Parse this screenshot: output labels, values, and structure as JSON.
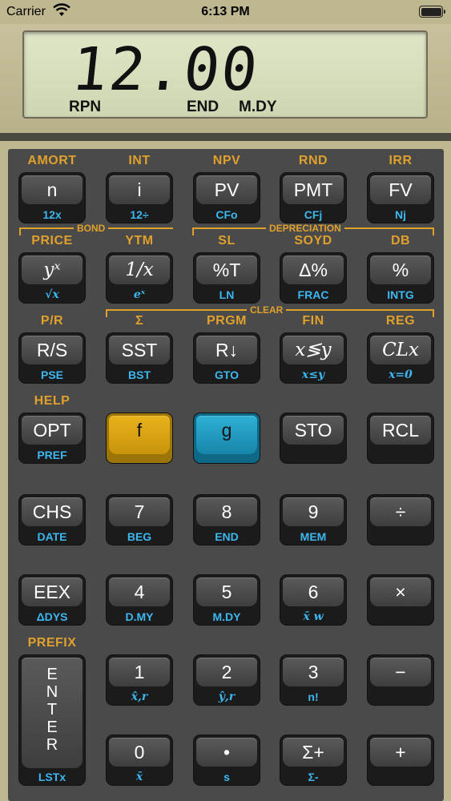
{
  "status_bar": {
    "carrier": "Carrier",
    "time": "6:13 PM"
  },
  "display": {
    "value": "12.00",
    "annunciators": [
      "RPN",
      "END",
      "M.DY"
    ]
  },
  "group_labels": {
    "bond": "BOND",
    "depreciation": "DEPRECIATION",
    "clear": "CLEAR"
  },
  "rows": [
    {
      "f_labels": [
        "AMORT",
        "INT",
        "NPV",
        "RND",
        "IRR"
      ],
      "keys": [
        {
          "main": "n",
          "g": "12x"
        },
        {
          "main": "i",
          "g": "12÷"
        },
        {
          "main": "PV",
          "g": "CFo"
        },
        {
          "main": "PMT",
          "g": "CFj"
        },
        {
          "main": "FV",
          "g": "Nj"
        }
      ]
    },
    {
      "f_labels": [
        "PRICE",
        "YTM",
        "SL",
        "SOYD",
        "DB"
      ],
      "keys": [
        {
          "main": "yˣ",
          "g": "√x"
        },
        {
          "main": "1/x",
          "g": "eˣ"
        },
        {
          "main": "%T",
          "g": "LN"
        },
        {
          "main": "Δ%",
          "g": "FRAC"
        },
        {
          "main": "%",
          "g": "INTG"
        }
      ]
    },
    {
      "f_labels": [
        "P/R",
        "Σ",
        "PRGM",
        "FIN",
        "REG"
      ],
      "keys": [
        {
          "main": "R/S",
          "g": "PSE"
        },
        {
          "main": "SST",
          "g": "BST"
        },
        {
          "main": "R↓",
          "g": "GTO"
        },
        {
          "main": "x≶y",
          "g": "x≤y"
        },
        {
          "main": "CLx",
          "g": "x=0"
        }
      ]
    },
    {
      "f_labels": [
        "HELP",
        "",
        "",
        "",
        ""
      ],
      "keys": [
        {
          "main": "OPT",
          "g": "PREF"
        },
        {
          "main": "f",
          "g": ""
        },
        {
          "main": "g",
          "g": ""
        },
        {
          "main": "STO",
          "g": ""
        },
        {
          "main": "RCL",
          "g": ""
        }
      ]
    },
    {
      "f_labels": [
        "",
        "",
        "",
        "",
        ""
      ],
      "keys": [
        {
          "main": "CHS",
          "g": "DATE"
        },
        {
          "main": "7",
          "g": "BEG"
        },
        {
          "main": "8",
          "g": "END"
        },
        {
          "main": "9",
          "g": "MEM"
        },
        {
          "main": "÷",
          "g": ""
        }
      ]
    },
    {
      "f_labels": [
        "",
        "",
        "",
        "",
        ""
      ],
      "keys": [
        {
          "main": "EEX",
          "g": "ΔDYS"
        },
        {
          "main": "4",
          "g": "D.MY"
        },
        {
          "main": "5",
          "g": "M.DY"
        },
        {
          "main": "6",
          "g": "x̄ w"
        },
        {
          "main": "×",
          "g": ""
        }
      ]
    },
    {
      "f_labels": [
        "PREFIX",
        "",
        "",
        "",
        ""
      ],
      "keys": [
        {
          "main": "ENTER",
          "g": "LSTx"
        },
        {
          "main": "1",
          "g": "x̂,r"
        },
        {
          "main": "2",
          "g": "ŷ,r"
        },
        {
          "main": "3",
          "g": "n!"
        },
        {
          "main": "−",
          "g": ""
        }
      ]
    },
    {
      "f_labels": [
        "",
        "",
        "",
        "",
        ""
      ],
      "keys": [
        {
          "main": "",
          "g": ""
        },
        {
          "main": "0",
          "g": "x̄"
        },
        {
          "main": "•",
          "g": "s"
        },
        {
          "main": "Σ+",
          "g": "Σ-"
        },
        {
          "main": "+",
          "g": ""
        }
      ]
    }
  ]
}
